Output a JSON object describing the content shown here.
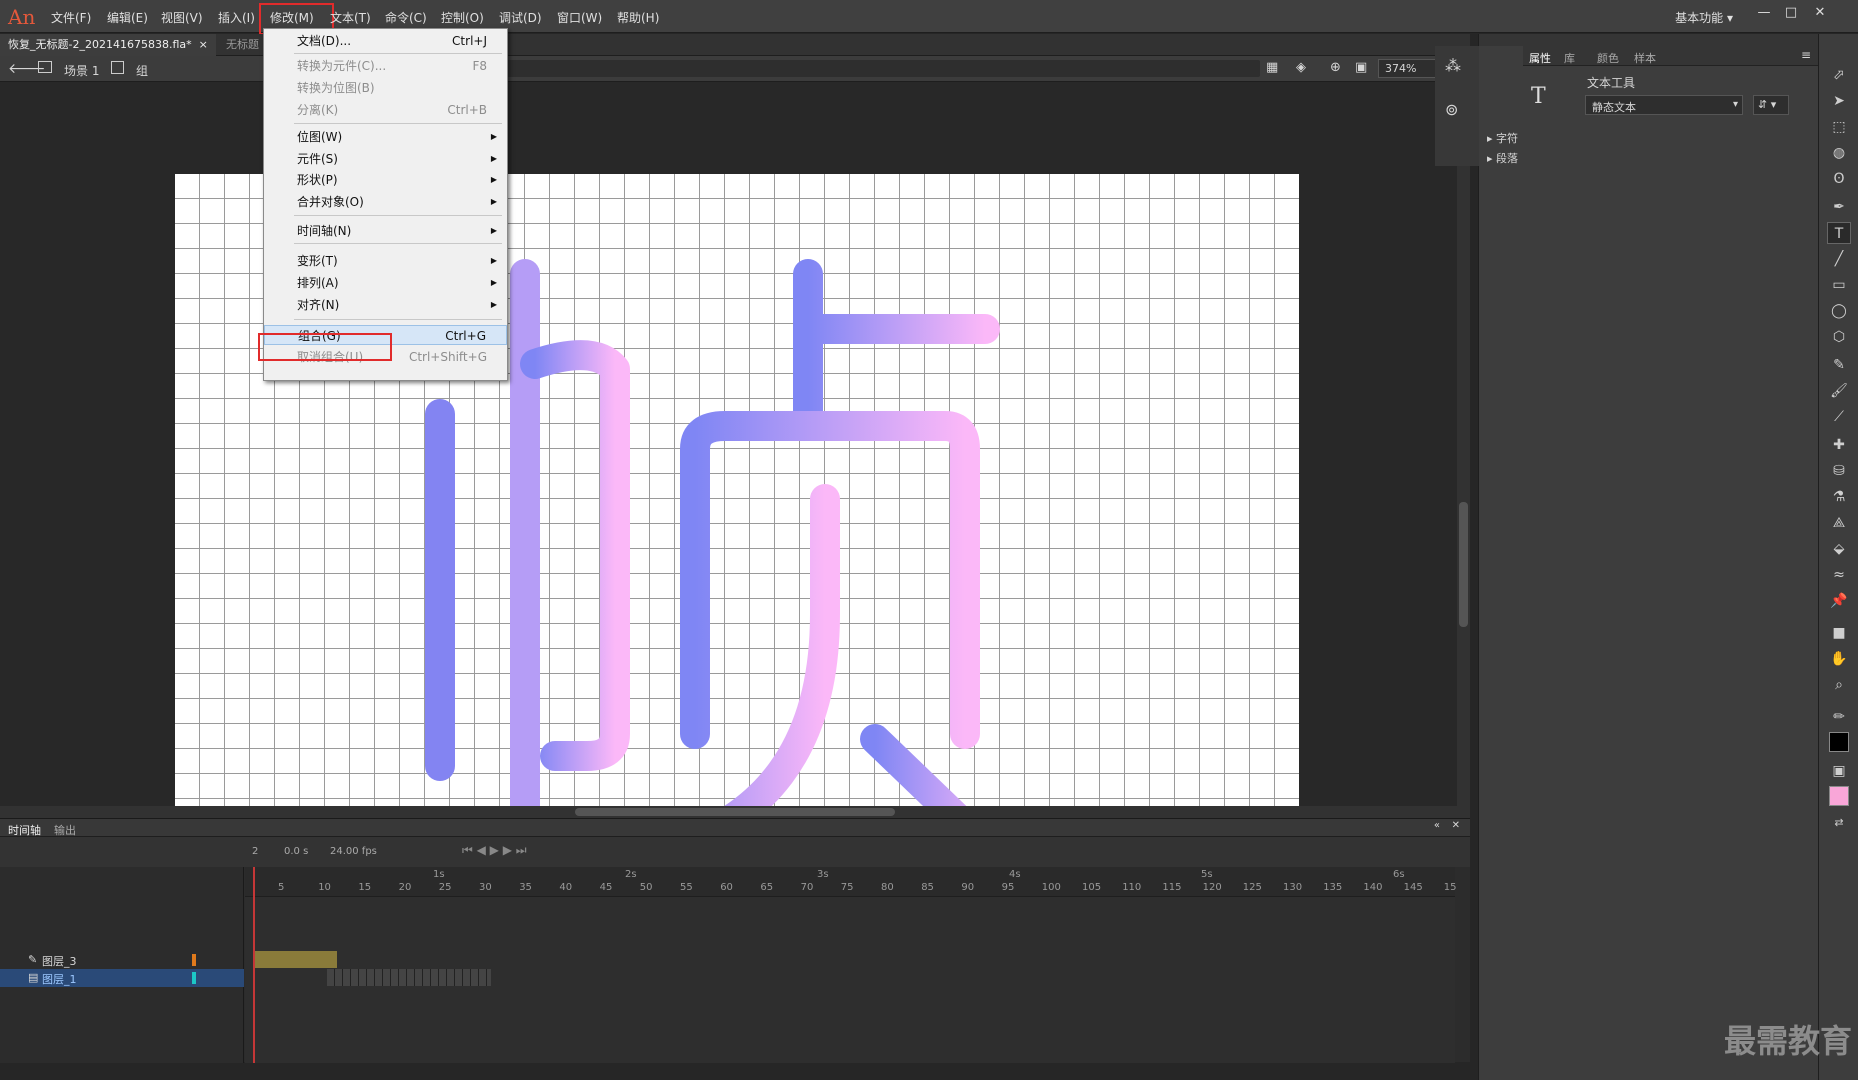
{
  "app": {
    "logo": "An",
    "workspace": "基本功能"
  },
  "menubar": {
    "items": [
      "文件(F)",
      "编辑(E)",
      "视图(V)",
      "插入(I)",
      "修改(M)",
      "文本(T)",
      "命令(C)",
      "控制(O)",
      "调试(D)",
      "窗口(W)",
      "帮助(H)"
    ]
  },
  "doc_tabs": [
    {
      "label": "恢复_无标题-2_202141675838.fla*",
      "close": "×"
    },
    {
      "label": "无标题"
    }
  ],
  "editbar": {
    "scene": "场景 1",
    "group": "组",
    "zoom": "374%"
  },
  "modify_menu": {
    "items": [
      {
        "label": "文档(D)...",
        "shortcut": "Ctrl+J"
      },
      {
        "label": "转换为元件(C)...",
        "shortcut": "F8",
        "disabled": true
      },
      {
        "label": "转换为位图(B)",
        "disabled": true
      },
      {
        "label": "分离(K)",
        "shortcut": "Ctrl+B",
        "disabled": true
      },
      {
        "label": "位图(W)",
        "submenu": true
      },
      {
        "label": "元件(S)",
        "submenu": true
      },
      {
        "label": "形状(P)",
        "submenu": true
      },
      {
        "label": "合并对象(O)",
        "submenu": true
      },
      {
        "label": "时间轴(N)",
        "submenu": true
      },
      {
        "label": "变形(T)",
        "submenu": true
      },
      {
        "label": "排列(A)",
        "submenu": true
      },
      {
        "label": "对齐(N)",
        "submenu": true
      },
      {
        "label": "组合(G)",
        "shortcut": "Ctrl+G",
        "highlighted": true
      },
      {
        "label": "取消组合(U)",
        "shortcut": "Ctrl+Shift+G",
        "disabled": true
      }
    ]
  },
  "timeline": {
    "tabs": [
      "时间轴",
      "输出"
    ],
    "frame": "2",
    "time": "0.0 s",
    "fps": "24.00 fps",
    "seconds": [
      "1s",
      "2s",
      "3s",
      "4s",
      "5s",
      "6s"
    ],
    "frames": [
      "5",
      "10",
      "15",
      "20",
      "25",
      "30",
      "35",
      "40",
      "45",
      "50",
      "55",
      "60",
      "65",
      "70",
      "75",
      "80",
      "85",
      "90",
      "95",
      "100",
      "105",
      "110",
      "115",
      "120",
      "125",
      "130",
      "135",
      "140",
      "145",
      "15"
    ],
    "layers": [
      {
        "name": "图层_3",
        "color": "#e07a1c"
      },
      {
        "name": "图层_1",
        "color": "#1cc7c7"
      }
    ]
  },
  "properties": {
    "tabs": [
      "属性",
      "库",
      "颜色",
      "样本"
    ],
    "tool_name": "文本工具",
    "text_type": "静态文本",
    "sections": [
      "字符",
      "段落"
    ]
  },
  "colors": {
    "accent_red": "#e12b2b",
    "gradient_start": "#7f86f4",
    "gradient_end": "#fbb8f8",
    "fill_swatch": "#f9a6d8"
  },
  "watermark": "最需教育"
}
